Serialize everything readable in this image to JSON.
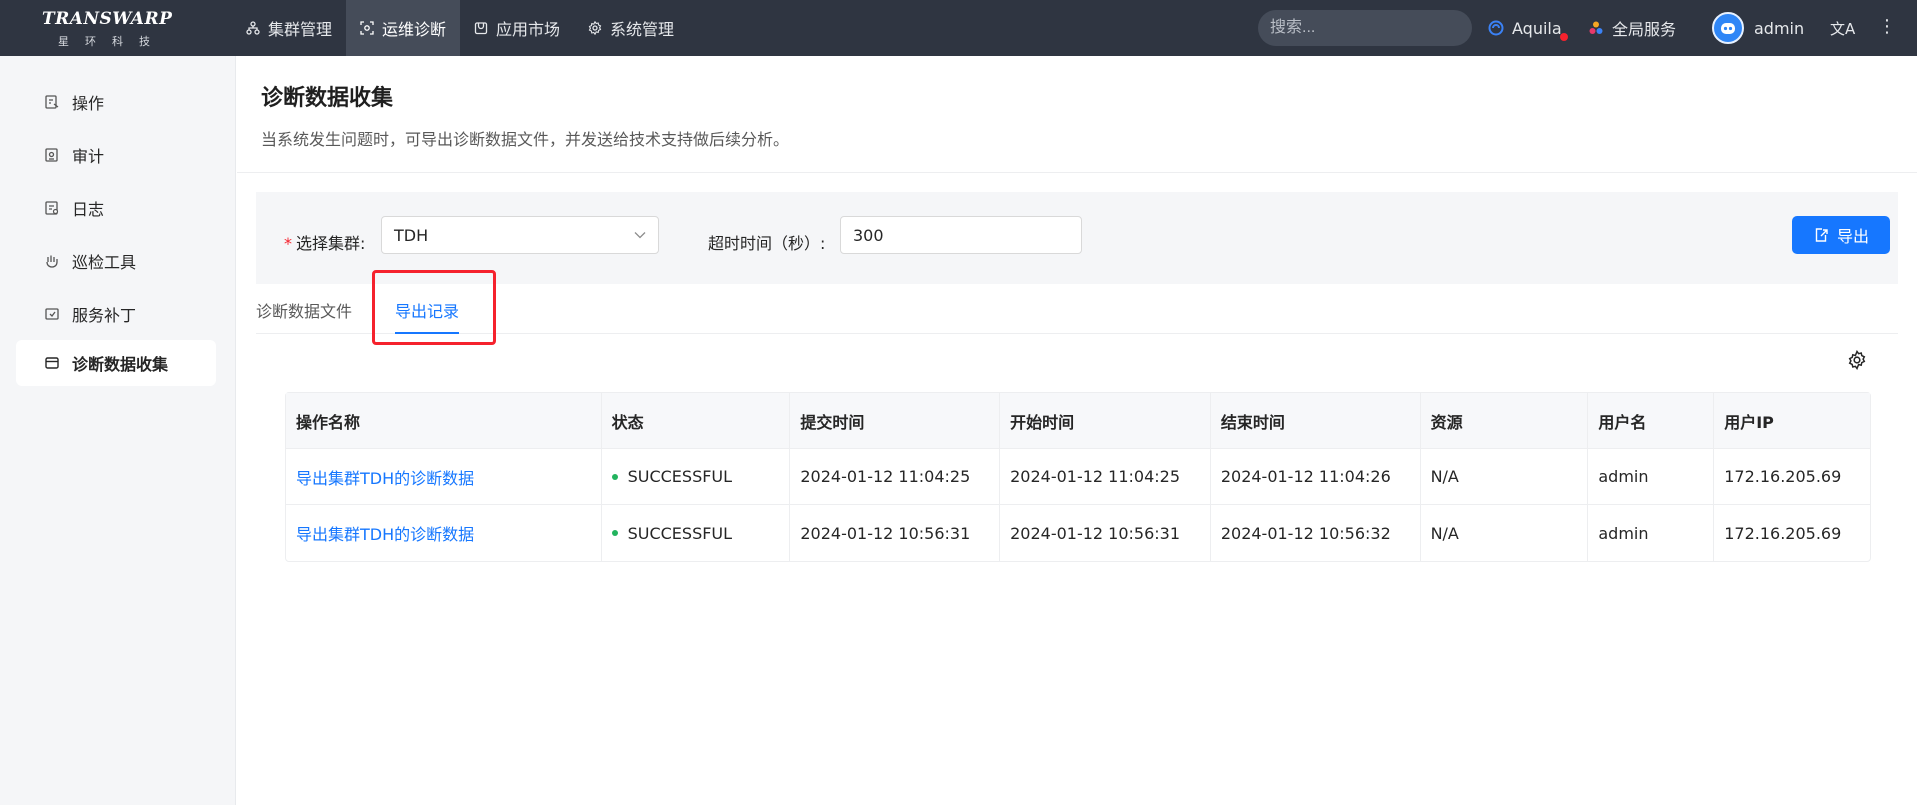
{
  "brand": {
    "name": "TRANSWARP",
    "subtitle": "星环科技"
  },
  "nav": [
    {
      "label": "集群管理",
      "icon": "cluster-icon",
      "active": false
    },
    {
      "label": "运维诊断",
      "icon": "diagnose-icon",
      "active": true
    },
    {
      "label": "应用市场",
      "icon": "market-icon",
      "active": false
    },
    {
      "label": "系统管理",
      "icon": "gear-icon",
      "active": false
    }
  ],
  "search": {
    "placeholder": "搜索..."
  },
  "topright": {
    "aquila": "Aquila",
    "global_service": "全局服务",
    "user": "admin",
    "lang_icon": "translate-icon",
    "more_icon": "more-vertical-icon"
  },
  "sidebar": {
    "items": [
      {
        "label": "操作",
        "icon": "operation-icon"
      },
      {
        "label": "审计",
        "icon": "audit-icon"
      },
      {
        "label": "日志",
        "icon": "log-icon"
      },
      {
        "label": "巡检工具",
        "icon": "inspect-icon"
      },
      {
        "label": "服务补丁",
        "icon": "patch-icon"
      },
      {
        "label": "诊断数据收集",
        "icon": "collect-icon",
        "active": true
      }
    ]
  },
  "page": {
    "title": "诊断数据收集",
    "description": "当系统发生问题时，可导出诊断数据文件，并发送给技术支持做后续分析。"
  },
  "filter": {
    "cluster_label": "选择集群:",
    "cluster_value": "TDH",
    "timeout_label": "超时时间（秒）:",
    "timeout_value": "300",
    "export_label": "导出"
  },
  "tabs": [
    {
      "label": "诊断数据文件",
      "active": false
    },
    {
      "label": "导出记录",
      "active": true
    }
  ],
  "table": {
    "headers": [
      "操作名称",
      "状态",
      "提交时间",
      "开始时间",
      "结束时间",
      "资源",
      "用户名",
      "用户IP"
    ],
    "rows": [
      [
        "导出集群TDH的诊断数据",
        "SUCCESSFUL",
        "2024-01-12 11:04:25",
        "2024-01-12 11:04:25",
        "2024-01-12 11:04:26",
        "N/A",
        "admin",
        "172.16.205.69"
      ],
      [
        "导出集群TDH的诊断数据",
        "SUCCESSFUL",
        "2024-01-12 10:56:31",
        "2024-01-12 10:56:31",
        "2024-01-12 10:56:32",
        "N/A",
        "admin",
        "172.16.205.69"
      ]
    ]
  },
  "colors": {
    "topbar": "#2f3541",
    "accent": "#1677ff",
    "success": "#22b35e",
    "highlight": "#f5222d"
  }
}
